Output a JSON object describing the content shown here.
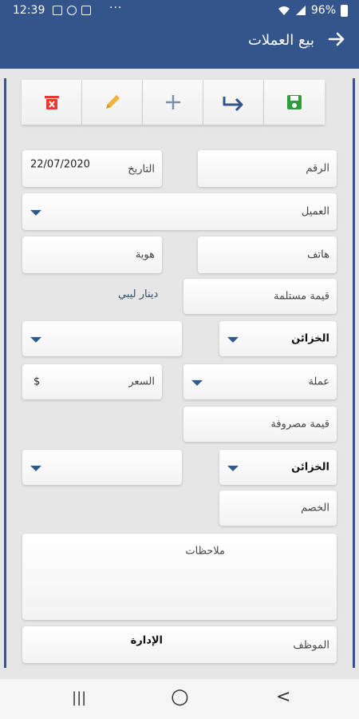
{
  "status": {
    "time": "12:39",
    "dots": "···",
    "battery": "96%"
  },
  "appbar": {
    "title": "بيع العملات",
    "back_icon": "arrow-right-icon"
  },
  "toolbar": {
    "buttons": [
      {
        "icon": "delete-icon",
        "color": "#e53935"
      },
      {
        "icon": "edit-icon",
        "color": "#f0b43c"
      },
      {
        "icon": "add-icon",
        "color": "#7a8fa6"
      },
      {
        "icon": "forward-icon",
        "color": "#34558b"
      },
      {
        "icon": "save-icon",
        "color": "#2e9b3e"
      }
    ]
  },
  "form": {
    "number_label": "الرقم",
    "date_label": "التاريخ",
    "date_value": "22/07/2020",
    "client_label": "العميل",
    "phone_label": "هاتف",
    "id_label": "هوية",
    "received_label": "قيمة مستلمة",
    "received_currency": "دينار ليبي",
    "treasury1_label": "الخزائن",
    "currency_label": "عملة",
    "rate_label": "السعر",
    "rate_currency": "$",
    "spent_label": "قيمة مصروفة",
    "treasury2_label": "الخزائن",
    "discount_label": "الخصم",
    "notes_label": "ملاحظات",
    "employee_label": "الموظف",
    "employee_value": "الإدارة"
  },
  "navbar": {
    "recent": "|||",
    "home": "○",
    "back": "<"
  }
}
